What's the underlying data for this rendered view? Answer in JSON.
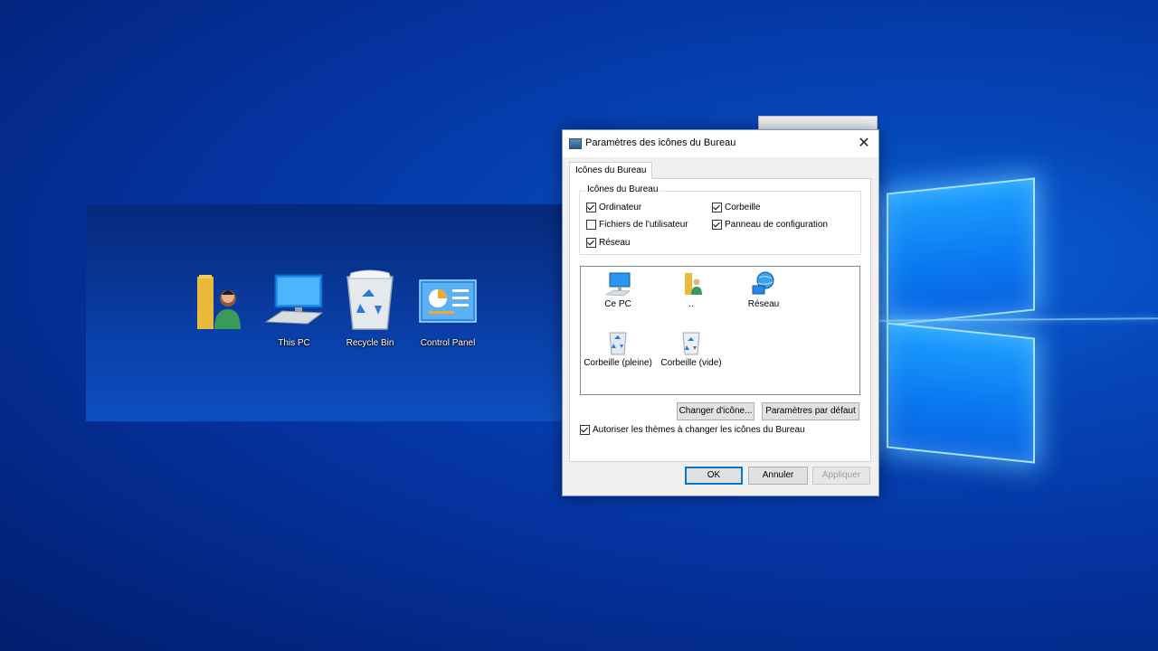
{
  "desktop": {
    "icons": [
      {
        "label": "",
        "icon": "user-folder-icon"
      },
      {
        "label": "This PC",
        "icon": "computer-icon"
      },
      {
        "label": "Recycle Bin",
        "icon": "recycle-bin-icon"
      },
      {
        "label": "Control Panel",
        "icon": "control-panel-icon"
      }
    ]
  },
  "dialog": {
    "title": "Paramètres des icônes du Bureau",
    "close_glyph": "✕",
    "tab_label": "Icônes du Bureau",
    "group_label": "Icônes du Bureau",
    "checkboxes": [
      {
        "label": "Ordinateur",
        "checked": true
      },
      {
        "label": "Corbeille",
        "checked": true
      },
      {
        "label": "Fichiers de l'utilisateur",
        "checked": false
      },
      {
        "label": "Panneau de configuration",
        "checked": true
      },
      {
        "label": "Réseau",
        "checked": true
      }
    ],
    "list_items": [
      {
        "label": "Ce PC",
        "icon": "computer-icon"
      },
      {
        "label": "..",
        "icon": "user-folder-icon"
      },
      {
        "label": "Réseau",
        "icon": "network-icon"
      },
      {
        "label": "Corbeille (pleine)",
        "icon": "recycle-bin-full-icon"
      },
      {
        "label": "Corbeille (vide)",
        "icon": "recycle-bin-empty-icon"
      }
    ],
    "change_icon_button": "Changer d'icône...",
    "default_button": "Paramètres par défaut",
    "allow_themes_label": "Autoriser les thèmes à changer les icônes du Bureau",
    "allow_themes_checked": true,
    "ok_button": "OK",
    "cancel_button": "Annuler",
    "apply_button": "Appliquer"
  },
  "colors": {
    "desktop_bg": "#0646b8",
    "accent": "#0078d7",
    "dialog_bg": "#f0f0f0"
  }
}
